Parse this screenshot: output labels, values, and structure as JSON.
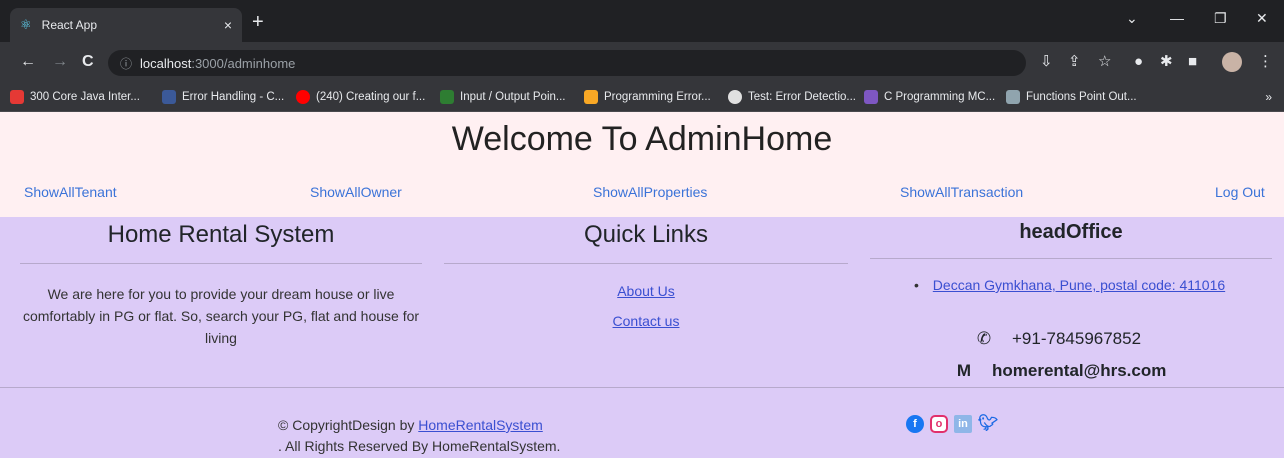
{
  "browser": {
    "tab_title": "React App",
    "tab_close": "×",
    "new_tab": "+",
    "url_host": "localhost",
    "url_path": ":3000/adminhome",
    "bookmarks": [
      {
        "label": "300 Core Java Inter...",
        "color": "#e53935"
      },
      {
        "label": "Error Handling - C...",
        "color": "#3b5998"
      },
      {
        "label": "(240) Creating our f...",
        "color": "#ff0000"
      },
      {
        "label": "Input / Output Poin...",
        "color": "#2e7d32"
      },
      {
        "label": "Programming Error...",
        "color": "#f9a825"
      },
      {
        "label": "Test: Error Detectio...",
        "color": "#e0e0e0"
      },
      {
        "label": "C Programming MC...",
        "color": "#7e57c2"
      },
      {
        "label": "Functions Point Out...",
        "color": "#90a4ae"
      }
    ],
    "bookmarks_more": "»"
  },
  "header": {
    "title": "Welcome To AdminHome",
    "nav": [
      "ShowAllTenant",
      "ShowAllOwner",
      "ShowAllProperties",
      "ShowAllTransaction",
      "Log Out"
    ]
  },
  "footer": {
    "about_title": "Home Rental System",
    "about_text": "We are here for you to provide your dream house or live comfortably in PG or flat. So, search your PG, flat and house for living",
    "links_title": "Quick Links",
    "links": [
      "About Us",
      "Contact us"
    ],
    "office_title": "headOffice",
    "address": "Deccan Gymkhana, Pune, postal code: 411016",
    "phone": "+91-7845967852",
    "email": "homerental@hrs.com",
    "copyright_prefix": "© CopyrightDesign by ",
    "copyright_link": "HomeRentalSystem",
    "copyright_suffix": ". All Rights Reserved By HomeRentalSystem.",
    "social_icons": [
      "facebook-icon",
      "instagram-icon",
      "linkedin-icon",
      "twitter-icon"
    ]
  }
}
